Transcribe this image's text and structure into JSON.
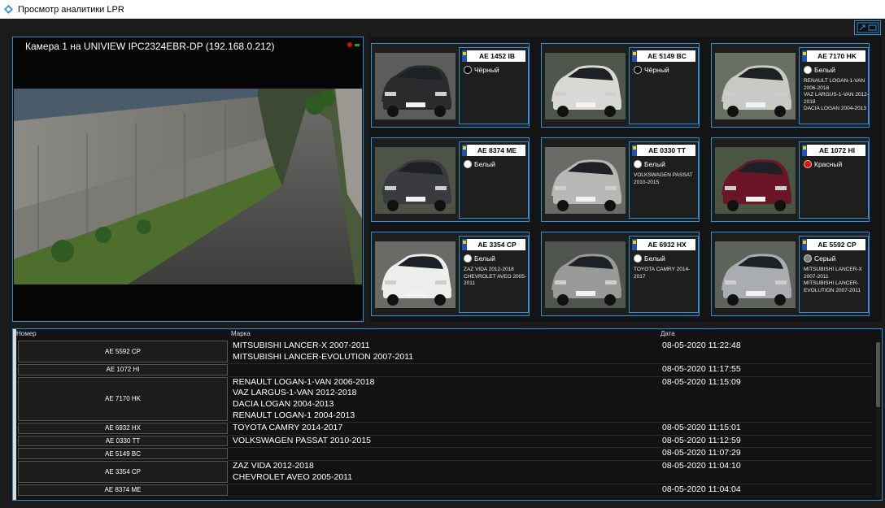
{
  "window": {
    "title": "Просмотр аналитики LPR"
  },
  "camera": {
    "title": "Камера 1 на UNIVIEW IPC2324EBR-DP (192.168.0.212)"
  },
  "recognitions": [
    {
      "plate": "AE 1452 IB",
      "color_name": "Чёрный",
      "color": "#000000",
      "models": ""
    },
    {
      "plate": "AE 5149 BC",
      "color_name": "Чёрный",
      "color": "#000000",
      "models": ""
    },
    {
      "plate": "AE 7170 HK",
      "color_name": "Белый",
      "color": "#ffffff",
      "models": "RENAULT LOGAN-1-VAN 2006-2018\nVAZ LARGUS-1-VAN 2012-2018\nDACIA LOGAN 2004-2013"
    },
    {
      "plate": "AE 8374 ME",
      "color_name": "Белый",
      "color": "#ffffff",
      "models": ""
    },
    {
      "plate": "AE 0330 TT",
      "color_name": "Белый",
      "color": "#ffffff",
      "models": "VOLKSWAGEN PASSAT 2010-2015"
    },
    {
      "plate": "AE 1072 HI",
      "color_name": "Красный",
      "color": "#e01010",
      "models": ""
    },
    {
      "plate": "AE 3354 CP",
      "color_name": "Белый",
      "color": "#ffffff",
      "models": "ZAZ VIDA 2012-2018\nCHEVROLET AVEO 2005-2011"
    },
    {
      "plate": "AE 6932 HX",
      "color_name": "Белый",
      "color": "#ffffff",
      "models": "TOYOTA CAMRY 2014-2017"
    },
    {
      "plate": "AE 5592 CP",
      "color_name": "Серый",
      "color": "#808080",
      "models": "MITSUBISHI LANCER-X 2007-2011\nMITSUBISHI LANCER-EVOLUTION 2007-2011"
    }
  ],
  "table": {
    "headers": {
      "plate": "Номер",
      "model": "Марка",
      "date": "Дата"
    },
    "rows": [
      {
        "plate": "AE 5592 CP",
        "model": "MITSUBISHI LANCER-X 2007-2011\nMITSUBISHI LANCER-EVOLUTION 2007-2011",
        "date": "08-05-2020 11:22:48"
      },
      {
        "plate": "AE 1072 HI",
        "model": "",
        "date": "08-05-2020 11:17:55"
      },
      {
        "plate": "AE 7170 HK",
        "model": "RENAULT LOGAN-1-VAN 2006-2018\nVAZ LARGUS-1-VAN 2012-2018\nDACIA LOGAN 2004-2013\nRENAULT LOGAN-1 2004-2013",
        "date": "08-05-2020 11:15:09"
      },
      {
        "plate": "AE 6932 HX",
        "model": "TOYOTA CAMRY 2014-2017",
        "date": "08-05-2020 11:15:01"
      },
      {
        "plate": "AE 0330 TT",
        "model": "VOLKSWAGEN PASSAT 2010-2015",
        "date": "08-05-2020 11:12:59"
      },
      {
        "plate": "AE 5149 BC",
        "model": "",
        "date": "08-05-2020 11:07:29"
      },
      {
        "plate": "AE 3354 CP",
        "model": "ZAZ VIDA 2012-2018\nCHEVROLET AVEO 2005-2011",
        "date": "08-05-2020 11:04:10"
      },
      {
        "plate": "AE 8374 ME",
        "model": "",
        "date": "08-05-2020 11:04:04"
      }
    ]
  }
}
